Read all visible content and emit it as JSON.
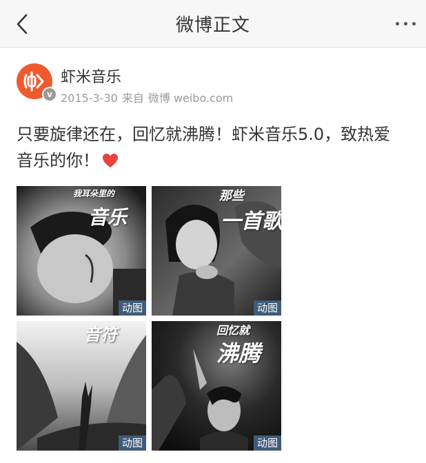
{
  "nav": {
    "back_icon": "chevron-left-icon",
    "title": "微博正文",
    "more_icon": "more-dots-icon"
  },
  "post": {
    "author": "虾米音乐",
    "avatar_icon": "xiami-logo",
    "verified_mark": "v",
    "date": "2015-3-30",
    "source_prefix": "来自",
    "source": "微博 weibo.com",
    "text_line1": "只要旋律还在，回忆就沸腾！虾米音乐5.0，致热爱",
    "text_line2": "音乐的你！",
    "emoji_icon": "red-heart-icon"
  },
  "images": [
    {
      "overlay_small": "我耳朵里的",
      "overlay_big": "音乐",
      "badge": "动图"
    },
    {
      "overlay_small": "那些",
      "overlay_big": "一首歌",
      "badge": "动图"
    },
    {
      "overlay_small": "",
      "overlay_big": "音符",
      "badge": "动图"
    },
    {
      "overlay_small": "回忆就",
      "overlay_big": "沸腾",
      "badge": "动图"
    }
  ],
  "colors": {
    "nav_bg": "#f7f7f7",
    "avatar_bg": "#ee5a30",
    "heart": "#e8453c",
    "gif_badge_bg": "#3f5b78",
    "meta_text": "#9a9a9a"
  }
}
